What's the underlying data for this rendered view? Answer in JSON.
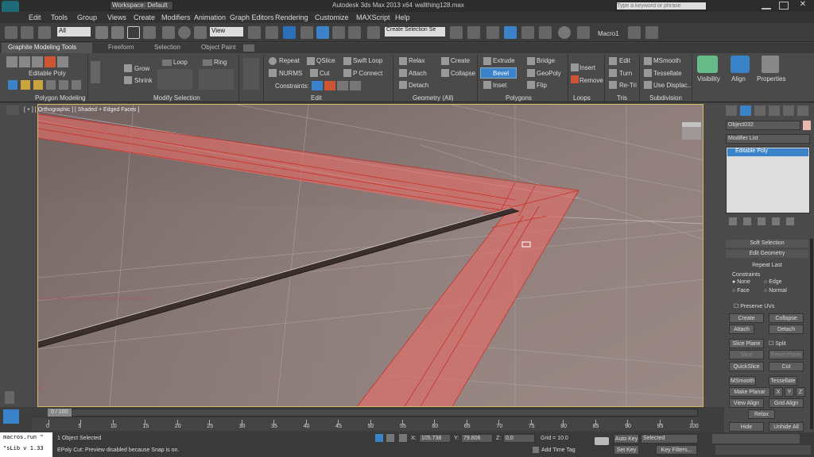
{
  "title": {
    "workspace": "Workspace: Default",
    "app": "Autodesk 3ds Max  2013 x64",
    "file": "wallthing128.max",
    "search_placeholder": "Type a keyword or phrase"
  },
  "menu": [
    "Edit",
    "Tools",
    "Group",
    "Views",
    "Create",
    "Modifiers",
    "Animation",
    "Graph Editors",
    "Rendering",
    "Customize",
    "MAXScript",
    "Help"
  ],
  "toolbar": {
    "filter": "All",
    "refcoord": "View",
    "selection_set": "Create Selection Se",
    "macro": "Macro1"
  },
  "ribbon_tabs": [
    "Graphite Modeling Tools",
    "Freeform",
    "Selection",
    "Object Paint"
  ],
  "ribbon": {
    "polygon_modeling": {
      "title": "Polygon Modeling",
      "label": "Editable Poly"
    },
    "modify_selection": {
      "title": "Modify Selection",
      "grow": "Grow",
      "shrink": "Shrink",
      "loop": "Loop",
      "ring": "Ring"
    },
    "edit": {
      "title": "Edit",
      "repeat": "Repeat",
      "qslice": "QSlice",
      "swift_loop": "Swift Loop",
      "nurms": "NURMS",
      "cut": "Cut",
      "p_connect": "P Connect",
      "constraints": "Constraints:"
    },
    "geometry": {
      "title": "Geometry (All)",
      "relax": "Relax",
      "create": "Create",
      "attach": "Attach",
      "collapse": "Collapse",
      "detach": "Detach"
    },
    "polygons": {
      "title": "Polygons",
      "extrude": "Extrude",
      "bridge": "Bridge",
      "bevel": "Bevel",
      "geopoly": "GeoPoly",
      "inset": "Inset",
      "flip": "Flip"
    },
    "loops": {
      "title": "Loops",
      "insert": "Insert",
      "remove": "Remove"
    },
    "tris": {
      "title": "Tris",
      "edit": "Edit",
      "turn": "Turn",
      "retri": "Re-Tri"
    },
    "subdivision": {
      "title": "Subdivision",
      "msmooth": "MSmooth",
      "tessellate": "Tessellate",
      "use_displac": "Use Displac..."
    },
    "visibility": "Visibility",
    "align": "Align",
    "properties": "Properties"
  },
  "viewport": {
    "label": "[ + ] [ Orthographic ] [ Shaded + Edged Faces ]"
  },
  "command_panel": {
    "object_name": "Object032",
    "modifier_list": "Modifier List",
    "stack_item": "Editable Poly",
    "soft_selection": "Soft Selection",
    "edit_geometry": "Edit Geometry",
    "repeat_last": "Repeat Last",
    "constraints_label": "Constraints",
    "c_none": "None",
    "c_edge": "Edge",
    "c_face": "Face",
    "c_normal": "Normal",
    "preserve_uvs": "Preserve UVs",
    "create": "Create",
    "collapse": "Collapse",
    "attach": "Attach",
    "detach": "Detach",
    "slice_plane": "Slice Plane",
    "split": "Split",
    "slice": "Slice",
    "reset_plane": "Reset Plane",
    "quickslice": "QuickSlice",
    "cut": "Cut",
    "msmooth": "MSmooth",
    "tessellate": "Tessellate",
    "make_planar": "Make Planar",
    "x": "X",
    "y": "Y",
    "z": "Z",
    "view_align": "View Align",
    "grid_align": "Grid Align",
    "relax": "Relax",
    "hide_selected": "Hide Selected",
    "unhide_all": "Unhide All"
  },
  "timeline": {
    "frame": "0 / 100",
    "ticks": [
      "0",
      "5",
      "10",
      "15",
      "20",
      "25",
      "30",
      "35",
      "40",
      "45",
      "50",
      "55",
      "60",
      "65",
      "70",
      "75",
      "80",
      "85",
      "90",
      "95",
      "100"
    ]
  },
  "status": {
    "listener_1": "macros.run \"",
    "listener_2": "\"sLib v 1.33",
    "selected": "1 Object Selected",
    "prompt": "EPoly Cut: Preview disabled because Snap is on.",
    "x_label": "X:",
    "x_val": "105.738",
    "y_label": "Y:",
    "y_val": "79.806",
    "z_label": "Z:",
    "z_val": "0.0",
    "grid": "Grid = 10.0",
    "add_time_tag": "Add Time Tag",
    "auto_key": "Auto Key",
    "set_key": "Set Key",
    "selected_dd": "Selected",
    "key_filters": "Key Filters..."
  }
}
